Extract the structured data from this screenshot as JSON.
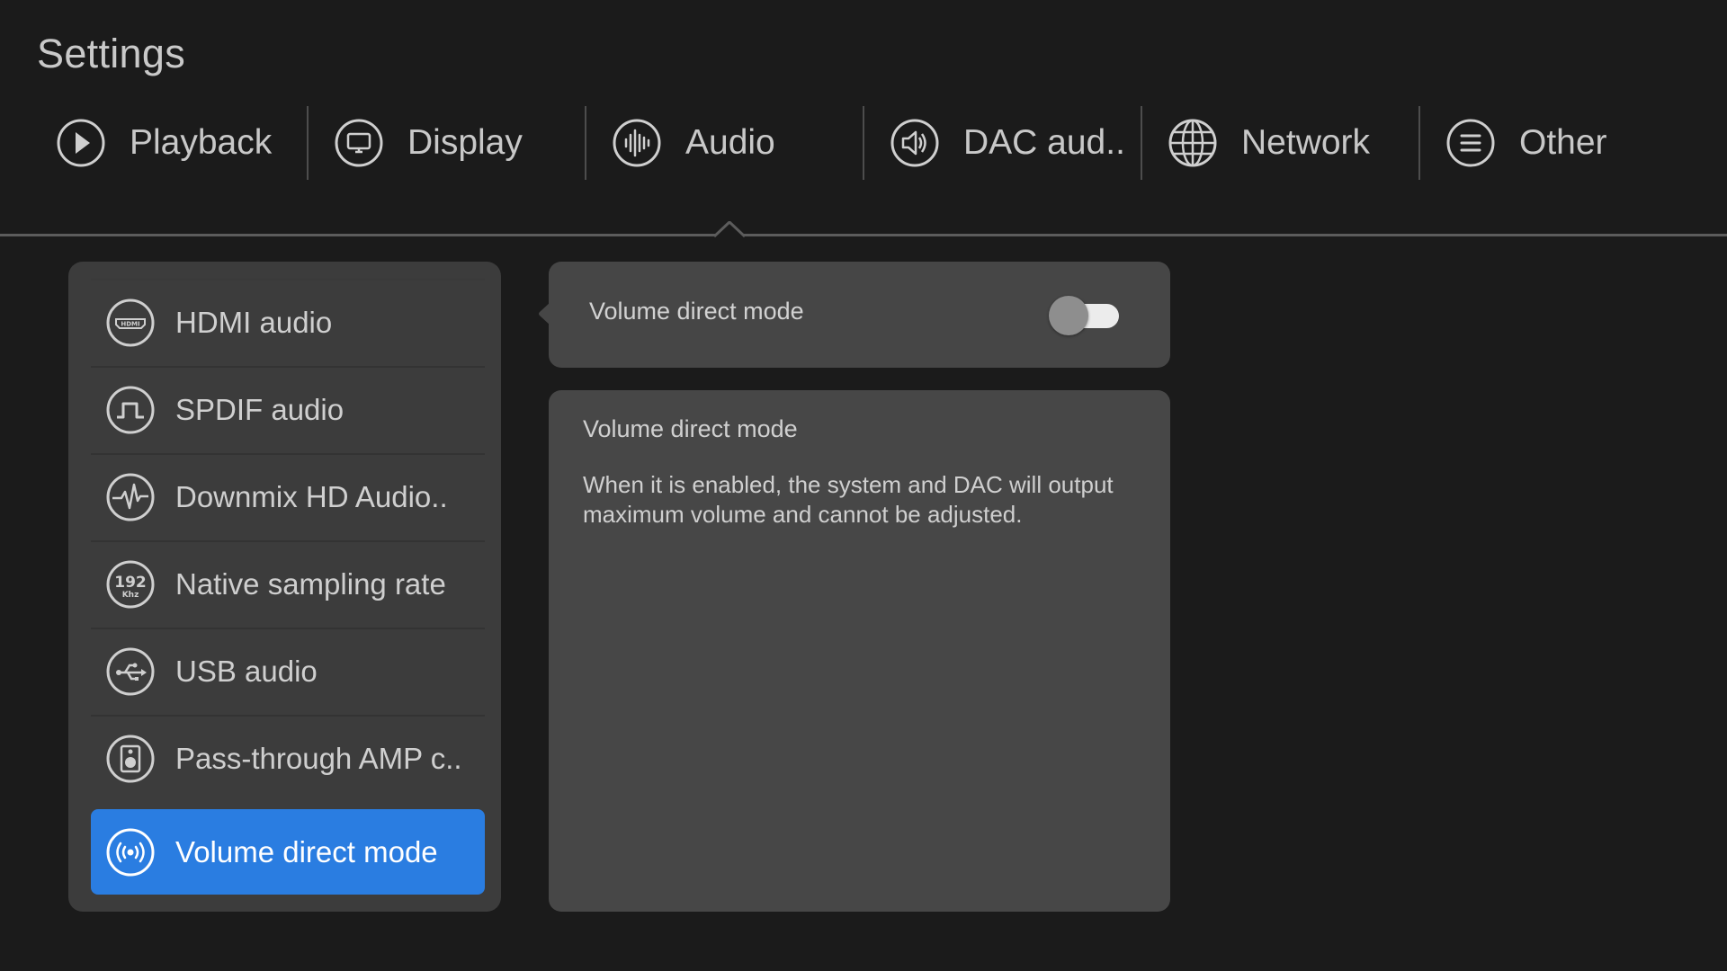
{
  "header": {
    "title": "Settings"
  },
  "tabs": [
    {
      "label": "Playback",
      "icon": "play-icon"
    },
    {
      "label": "Display",
      "icon": "monitor-icon"
    },
    {
      "label": "Audio",
      "icon": "audio-waveform-icon",
      "selected": true
    },
    {
      "label": "DAC aud..",
      "icon": "speaker-icon"
    },
    {
      "label": "Network",
      "icon": "globe-icon"
    },
    {
      "label": "Other",
      "icon": "list-icon"
    }
  ],
  "menu": {
    "items": [
      {
        "label": "HDMI audio",
        "icon": "hdmi-icon"
      },
      {
        "label": "SPDIF audio",
        "icon": "spdif-icon"
      },
      {
        "label": "Downmix HD Audio..",
        "icon": "pulse-icon"
      },
      {
        "label": "Native sampling rate",
        "icon": "sampling-rate-icon",
        "icon_text": "192",
        "icon_subtext": "Khz"
      },
      {
        "label": "USB audio",
        "icon": "usb-icon"
      },
      {
        "label": "Pass-through AMP c..",
        "icon": "amp-speaker-icon"
      },
      {
        "label": "Volume direct mode",
        "icon": "broadcast-icon",
        "selected": true
      }
    ]
  },
  "detail": {
    "toggle_label": "Volume direct mode",
    "toggle_on": false,
    "description_title": "Volume direct mode",
    "description_body": "When it is enabled, the system and DAC will output maximum volume and cannot be adjusted."
  },
  "colors": {
    "background": "#1b1b1b",
    "panel": "#3c3c3c",
    "card": "#464646",
    "accent": "#2a7de1",
    "text": "#d2d2d2"
  }
}
